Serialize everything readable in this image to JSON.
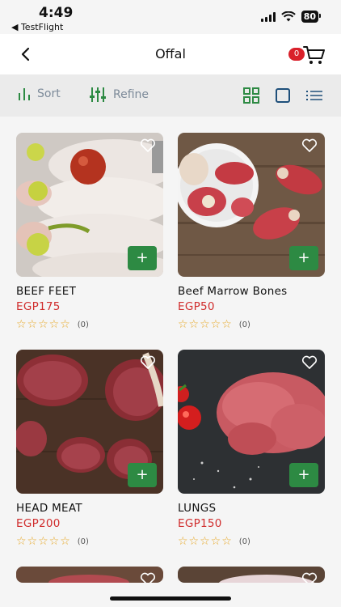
{
  "status": {
    "time": "4:49",
    "back_app": "◀ TestFlight",
    "battery": "80"
  },
  "header": {
    "title": "Offal",
    "cart_count": "0"
  },
  "toolbar": {
    "sort_label": "Sort",
    "refine_label": "Refine"
  },
  "products": [
    {
      "name": "BEEF FEET",
      "price": "EGP175",
      "stars": "☆☆☆☆☆",
      "reviews": "(0)"
    },
    {
      "name": "Beef Marrow Bones",
      "price": "EGP50",
      "stars": "☆☆☆☆☆",
      "reviews": "(0)"
    },
    {
      "name": "HEAD MEAT",
      "price": "EGP200",
      "stars": "☆☆☆☆☆",
      "reviews": "(0)"
    },
    {
      "name": "LUNGS",
      "price": "EGP150",
      "stars": "☆☆☆☆☆",
      "reviews": "(0)"
    }
  ],
  "add_label": "+",
  "colors": {
    "accent_green": "#2d8a43",
    "price_red": "#d02c2c",
    "star_gold": "#e7a827",
    "badge_red": "#d9202a"
  }
}
